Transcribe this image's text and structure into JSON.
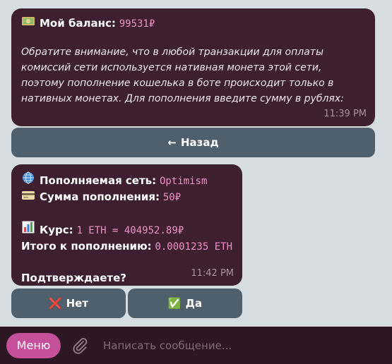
{
  "msg1": {
    "balance_label": "Мой баланс:",
    "balance_value": "99531₽",
    "notice": "Обратите внимание, что в любой транзакции для оплаты комиссий сети используется нативная монета этой сети, поэтому пополнение кошелька в боте происходит только в нативных монетах. Для пополнения введите сумму в рублях:",
    "time": "11:39 PM"
  },
  "back_button": {
    "label": "Назад",
    "icon": "←"
  },
  "msg2": {
    "network_label": "Пополняемая сеть:",
    "network_value": "Optimism",
    "amount_label": "Сумма пополнения:",
    "amount_value": "50₽",
    "rate_label": "Курс:",
    "rate_value": "1 ETH = 404952.89₽",
    "total_label": "Итого к пополнению:",
    "total_value": "0.0001235 ETH",
    "question": "Подтверждаете?",
    "time": "11:42 PM"
  },
  "no_button": {
    "label": "Нет",
    "icon": "❌"
  },
  "yes_button": {
    "label": "Да",
    "icon": "✅"
  },
  "composer": {
    "menu_label": "Меню",
    "placeholder": "Написать сообщение..."
  },
  "colors": {
    "bubble": "#3d1f2f",
    "accent": "#c54f9b",
    "mono_text": "#f08fc8",
    "keyboard_button": "#4f5f6c",
    "background": "#d5dde2"
  }
}
